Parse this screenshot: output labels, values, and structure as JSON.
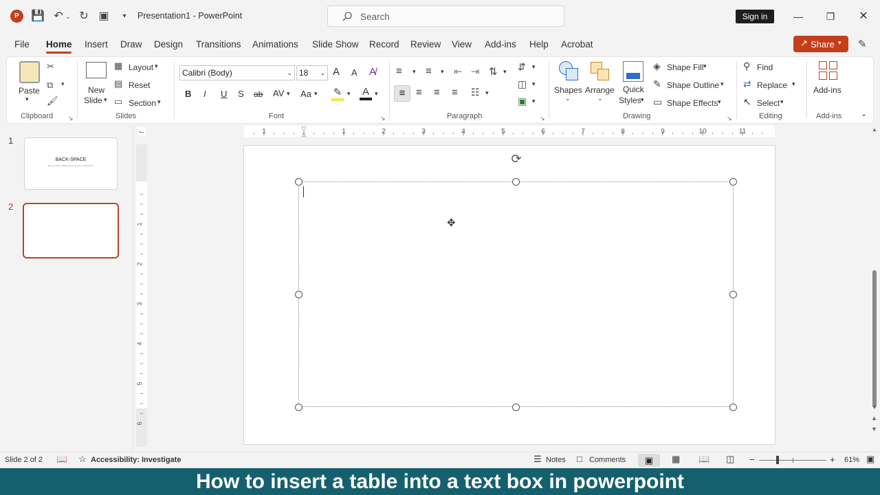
{
  "app": {
    "name": "PowerPoint",
    "document": "Presentation1",
    "title_sep": " - "
  },
  "titlebar": {
    "search_placeholder": "Search",
    "sign_in": "Sign in"
  },
  "menu": {
    "tabs": [
      "File",
      "Home",
      "Insert",
      "Draw",
      "Design",
      "Transitions",
      "Animations",
      "Slide Show",
      "Record",
      "Review",
      "View",
      "Add-ins",
      "Help",
      "Acrobat"
    ],
    "active": "Home",
    "share": "Share"
  },
  "ribbon": {
    "clipboard": {
      "label": "Clipboard",
      "paste": "Paste"
    },
    "slides": {
      "label": "Slides",
      "new_slide_1": "New",
      "new_slide_2": "Slide",
      "layout": "Layout",
      "reset": "Reset",
      "section": "Section"
    },
    "font": {
      "label": "Font",
      "family": "Calibri (Body)",
      "size": "18",
      "bold": "B",
      "italic": "I",
      "underline": "U",
      "shadow": "S",
      "strike": "ab",
      "spacing": "AV",
      "case": "Aa",
      "grow": "A",
      "shrink": "A"
    },
    "paragraph": {
      "label": "Paragraph"
    },
    "drawing": {
      "label": "Drawing",
      "shapes": "Shapes",
      "arrange": "Arrange",
      "quick_1": "Quick",
      "quick_2": "Styles",
      "fill": "Shape Fill",
      "outline": "Shape Outline",
      "effects": "Shape Effects"
    },
    "editing": {
      "label": "Editing",
      "find": "Find",
      "replace": "Replace",
      "select": "Select"
    },
    "addins": {
      "label": "Add-ins",
      "button": "Add-ins"
    }
  },
  "slides_panel": {
    "items": [
      {
        "number": "1",
        "title": "BACK-SPACE",
        "subtitle": "How to insert a table into a text box in PowerPoint"
      },
      {
        "number": "2"
      }
    ],
    "selected": "2"
  },
  "ruler": {
    "h_ticks": [
      "1",
      "1",
      "2",
      "3",
      "4",
      "5",
      "6",
      "7",
      "8",
      "9",
      "10",
      "11"
    ],
    "v_ticks": [
      "1",
      "2",
      "3",
      "4",
      "5",
      "6"
    ]
  },
  "status": {
    "slide": "Slide 2 of 2",
    "accessibility": "Accessibility: Investigate",
    "notes": "Notes",
    "comments": "Comments",
    "zoom": "61%",
    "minus": "−",
    "plus": "+"
  },
  "caption": "How to insert a table into a text box in powerpoint",
  "colors": {
    "accent": "#c43e1c",
    "caption_bg": "#15606e"
  }
}
